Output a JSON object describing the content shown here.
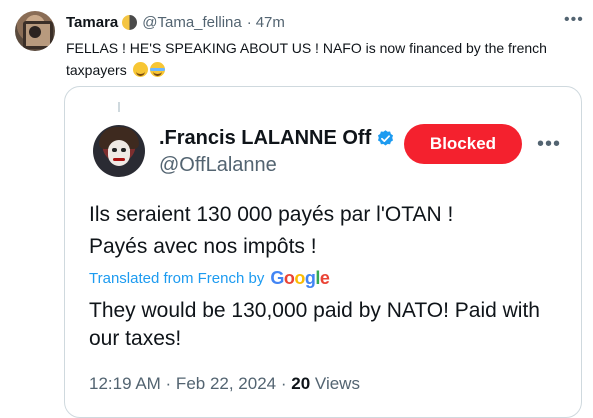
{
  "outer_tweet": {
    "name": "Tamara",
    "handle": "@Tama_fellina",
    "dot": "·",
    "time": "47m",
    "text": "FELLAS ! HE'S SPEAKING ABOUT US ! NAFO is now financed by the french taxpayers"
  },
  "quoted_tweet": {
    "name": ".Francis LALANNE Off",
    "handle": "@OffLalanne",
    "blocked_label": "Blocked",
    "text_fr_line1": "Ils seraient 130 000 payés par l'OTAN !",
    "text_fr_line2": "Payés avec nos impôts !",
    "translated_label": "Translated from French by",
    "translated_by": "Google",
    "text_en": "They would be 130,000 paid by NATO! Paid with our taxes!",
    "timestamp": "12:19 AM · Feb 22, 2024 ·",
    "views_count": "20",
    "views_label": "Views"
  },
  "colors": {
    "accent": "#1d9bf0",
    "blocked_red": "#f4212e",
    "secondary_text": "#536471"
  },
  "icons": {
    "more": "more-horizontal-icon",
    "verified": "verified-badge-icon",
    "emoji1": "pleading-face-emoji",
    "emoji2": "tears-of-joy-emoji"
  }
}
